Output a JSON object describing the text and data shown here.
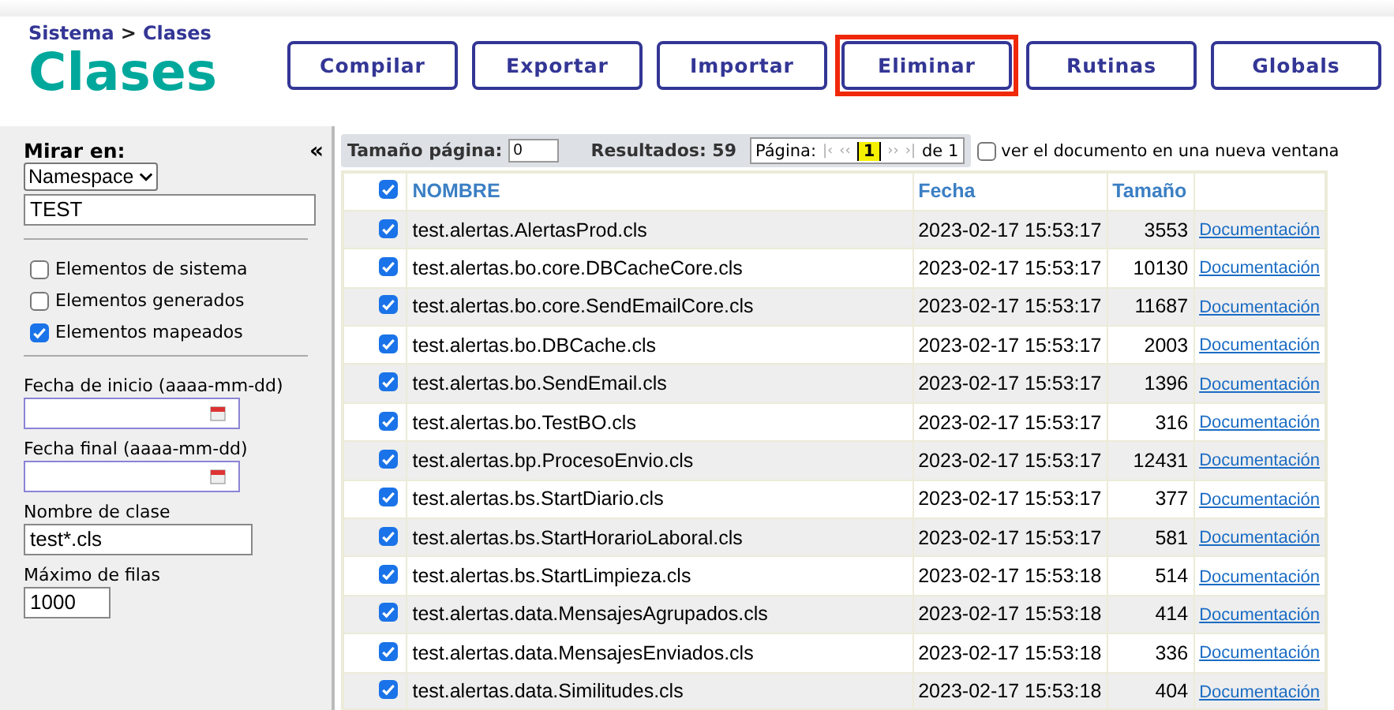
{
  "breadcrumb": {
    "parent": "Sistema",
    "separator": ">",
    "current": "Clases"
  },
  "title": "Clases",
  "buttons": [
    {
      "label": "Compilar",
      "highlighted": false
    },
    {
      "label": "Exportar",
      "highlighted": false
    },
    {
      "label": "Importar",
      "highlighted": false
    },
    {
      "label": "Eliminar",
      "highlighted": true
    },
    {
      "label": "Rutinas",
      "highlighted": false
    },
    {
      "label": "Globals",
      "highlighted": false
    }
  ],
  "sidebar": {
    "collapse": "«",
    "look_in_label": "Mirar en:",
    "look_in_select": "Namespace",
    "namespace": "TEST",
    "options": [
      {
        "label": "Elementos de sistema",
        "checked": false
      },
      {
        "label": "Elementos generados",
        "checked": false
      },
      {
        "label": "Elementos mapeados",
        "checked": true
      }
    ],
    "start_date_label": "Fecha de inicio (aaaa-mm-dd)",
    "end_date_label": "Fecha final (aaaa-mm-dd)",
    "class_name_label": "Nombre de clase",
    "class_name": "test*.cls",
    "max_rows_label": "Máximo de filas",
    "max_rows": "1000"
  },
  "toolbar": {
    "page_size_label": "Tamaño página:",
    "page_size": "0",
    "results": "Resultados: 59",
    "page_label": "Página:",
    "first": "|‹",
    "prev": "‹‹",
    "page": "1",
    "next": "››",
    "last": "›|",
    "of": "de 1",
    "new_window": {
      "label": "ver el documento en una nueva ventana",
      "checked": false
    }
  },
  "table": {
    "select_all": true,
    "columns": [
      "NOMBRE",
      "Fecha",
      "Tamaño"
    ],
    "rows": [
      {
        "checked": true,
        "name": "test.alertas.AlertasProd.cls",
        "date": "2023-02-17 15:53:17",
        "size": "3553",
        "link": "Documentación"
      },
      {
        "checked": true,
        "name": "test.alertas.bo.core.DBCacheCore.cls",
        "date": "2023-02-17 15:53:17",
        "size": "10130",
        "link": "Documentación"
      },
      {
        "checked": true,
        "name": "test.alertas.bo.core.SendEmailCore.cls",
        "date": "2023-02-17 15:53:17",
        "size": "11687",
        "link": "Documentación"
      },
      {
        "checked": true,
        "name": "test.alertas.bo.DBCache.cls",
        "date": "2023-02-17 15:53:17",
        "size": "2003",
        "link": "Documentación"
      },
      {
        "checked": true,
        "name": "test.alertas.bo.SendEmail.cls",
        "date": "2023-02-17 15:53:17",
        "size": "1396",
        "link": "Documentación"
      },
      {
        "checked": true,
        "name": "test.alertas.bo.TestBO.cls",
        "date": "2023-02-17 15:53:17",
        "size": "316",
        "link": "Documentación"
      },
      {
        "checked": true,
        "name": "test.alertas.bp.ProcesoEnvio.cls",
        "date": "2023-02-17 15:53:17",
        "size": "12431",
        "link": "Documentación"
      },
      {
        "checked": true,
        "name": "test.alertas.bs.StartDiario.cls",
        "date": "2023-02-17 15:53:17",
        "size": "377",
        "link": "Documentación"
      },
      {
        "checked": true,
        "name": "test.alertas.bs.StartHorarioLaboral.cls",
        "date": "2023-02-17 15:53:17",
        "size": "581",
        "link": "Documentación"
      },
      {
        "checked": true,
        "name": "test.alertas.bs.StartLimpieza.cls",
        "date": "2023-02-17 15:53:18",
        "size": "514",
        "link": "Documentación"
      },
      {
        "checked": true,
        "name": "test.alertas.data.MensajesAgrupados.cls",
        "date": "2023-02-17 15:53:18",
        "size": "414",
        "link": "Documentación"
      },
      {
        "checked": true,
        "name": "test.alertas.data.MensajesEnviados.cls",
        "date": "2023-02-17 15:53:18",
        "size": "336",
        "link": "Documentación"
      },
      {
        "checked": true,
        "name": "test.alertas.data.Similitudes.cls",
        "date": "2023-02-17 15:53:18",
        "size": "404",
        "link": "Documentación"
      }
    ]
  }
}
